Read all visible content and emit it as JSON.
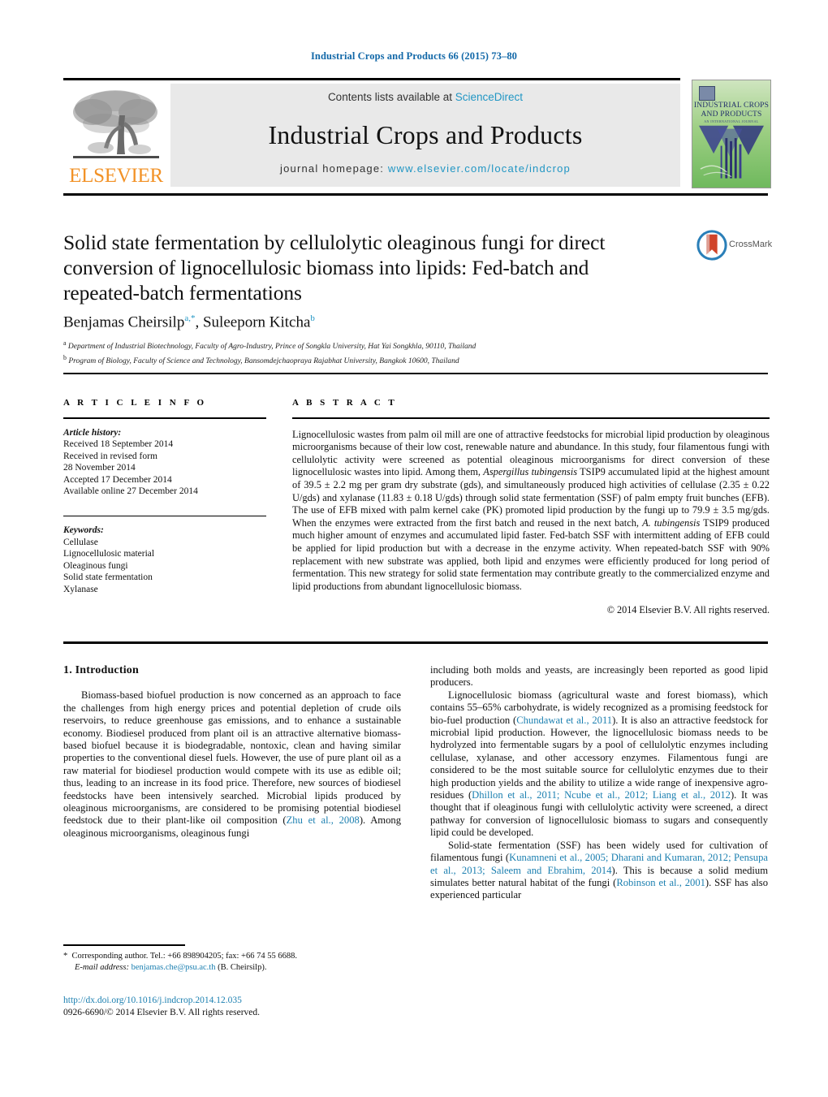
{
  "running_head": "Industrial Crops and Products 66 (2015) 73–80",
  "masthead": {
    "contents_prefix": "Contents lists available at ",
    "sciencedirect": "ScienceDirect",
    "journal_title": "Industrial Crops and Products",
    "homepage_prefix": "journal homepage: ",
    "homepage_url": "www.elsevier.com/locate/indcrop",
    "publisher_logo_text": "ELSEVIER",
    "cover_title": "INDUSTRIAL CROPS AND PRODUCTS",
    "cover_subtitle": "AN INTERNATIONAL JOURNAL",
    "crossmark_label": "CrossMark",
    "link_color": "#2196c4"
  },
  "article": {
    "title": "Solid state fermentation by cellulolytic oleaginous fungi for direct conversion of lignocellulosic biomass into lipids: Fed-batch and repeated-batch fermentations",
    "authors_html": "Benjamas Cheirsilp<sup>a,*</sup>, Suleeporn Kitcha<sup>b</sup>",
    "affiliation_a": "Department of Industrial Biotechnology, Faculty of Agro-Industry, Prince of Songkla University, Hat Yai Songkhla, 90110, Thailand",
    "affiliation_b": "Program of Biology, Faculty of Science and Technology, Bansomdejchaopraya Rajabhat University, Bangkok 10600, Thailand"
  },
  "article_info": {
    "heading": "A R T I C L E   I N F O",
    "history_label": "Article history:",
    "history": [
      "Received 18 September 2014",
      "Received in revised form",
      "28 November 2014",
      "Accepted 17 December 2014",
      "Available online 27 December 2014"
    ],
    "keywords_label": "Keywords:",
    "keywords": [
      "Cellulase",
      "Lignocellulosic material",
      "Oleaginous fungi",
      "Solid state fermentation",
      "Xylanase"
    ]
  },
  "abstract": {
    "heading": "A B S T R A C T",
    "text": "Lignocellulosic wastes from palm oil mill are one of attractive feedstocks for microbial lipid production by oleaginous microorganisms because of their low cost, renewable nature and abundance. In this study, four filamentous fungi with cellulolytic activity were screened as potential oleaginous microorganisms for direct conversion of these lignocellulosic wastes into lipid. Among them, Aspergillus tubingensis TSIP9 accumulated lipid at the highest amount of 39.5 ± 2.2 mg per gram dry substrate (gds), and simultaneously produced high activities of cellulase (2.35 ± 0.22 U/gds) and xylanase (11.83 ± 0.18 U/gds) through solid state fermentation (SSF) of palm empty fruit bunches (EFB). The use of EFB mixed with palm kernel cake (PK) promoted lipid production by the fungi up to 79.9 ± 3.5 mg/gds. When the enzymes were extracted from the first batch and reused in the next batch, A. tubingensis TSIP9 produced much higher amount of enzymes and accumulated lipid faster. Fed-batch SSF with intermittent adding of EFB could be applied for lipid production but with a decrease in the enzyme activity. When repeated-batch SSF with 90% replacement with new substrate was applied, both lipid and enzymes were efficiently produced for long period of fermentation. This new strategy for solid state fermentation may contribute greatly to the commercialized enzyme and lipid productions from abundant lignocellulosic biomass.",
    "copyright": "© 2014 Elsevier B.V. All rights reserved."
  },
  "body": {
    "section_heading": "1.  Introduction",
    "left_paragraph_1": "Biomass-based biofuel production is now concerned as an approach to face the challenges from high energy prices and potential depletion of crude oils reservoirs, to reduce greenhouse gas emissions, and to enhance a sustainable economy. Biodiesel produced from plant oil is an attractive alternative biomass-based biofuel because it is biodegradable, nontoxic, clean and having similar properties to the conventional diesel fuels. However, the use of pure plant oil as a raw material for biodiesel production would compete with its use as edible oil; thus, leading to an increase in its food price. Therefore, new sources of biodiesel feedstocks have been intensively searched. Microbial lipids produced by oleaginous microorganisms, are considered to be promising potential biodiesel feedstock due to their plant-like oil composition (",
    "left_ref_1": "Zhu et al., 2008",
    "left_paragraph_1_tail": "). Among oleaginous microorganisms, oleaginous fungi",
    "right_paragraph_1_cont": "including both molds and yeasts, are increasingly been reported as good lipid producers.",
    "right_paragraph_2_a": "Lignocellulosic biomass (agricultural waste and forest biomass), which contains 55–65% carbohydrate, is widely recognized as a promising feedstock for bio-fuel production (",
    "right_ref_1": "Chundawat et al., 2011",
    "right_paragraph_2_b": "). It is also an attractive feedstock for microbial lipid production. However, the lignocellulosic biomass needs to be hydrolyzed into fermentable sugars by a pool of cellulolytic enzymes including cellulase, xylanase, and other accessory enzymes. Filamentous fungi are considered to be the most suitable source for cellulolytic enzymes due to their high production yields and the ability to utilize a wide range of inexpensive agro-residues (",
    "right_ref_2": "Dhillon et al., 2011; Ncube et al., 2012; Liang et al., 2012",
    "right_paragraph_2_c": "). It was thought that if oleaginous fungi with cellulolytic activity were screened, a direct pathway for conversion of lignocellulosic biomass to sugars and consequently lipid could be developed.",
    "right_paragraph_3_a": "Solid-state fermentation (SSF) has been widely used for cultivation of filamentous fungi (",
    "right_ref_3": "Kunamneni et al., 2005; Dharani and Kumaran, 2012; Pensupa et al., 2013; Saleem and Ebrahim, 2014",
    "right_paragraph_3_b": "). This is because a solid medium simulates better natural habitat of the fungi (",
    "right_ref_4": "Robinson et al., 2001",
    "right_paragraph_3_c": "). SSF has also experienced particular"
  },
  "footer": {
    "corresponding_marker": "*",
    "corresponding_text": "Corresponding author. Tel.: +66 898904205; fax: +66 74 55 6688.",
    "email_label": "E-mail address:",
    "email": "benjamas.che@psu.ac.th",
    "email_owner": "(B. Cheirsilp).",
    "doi_url": "http://dx.doi.org/10.1016/j.indcrop.2014.12.035",
    "issn_line": "0926-6690/© 2014 Elsevier B.V. All rights reserved."
  }
}
